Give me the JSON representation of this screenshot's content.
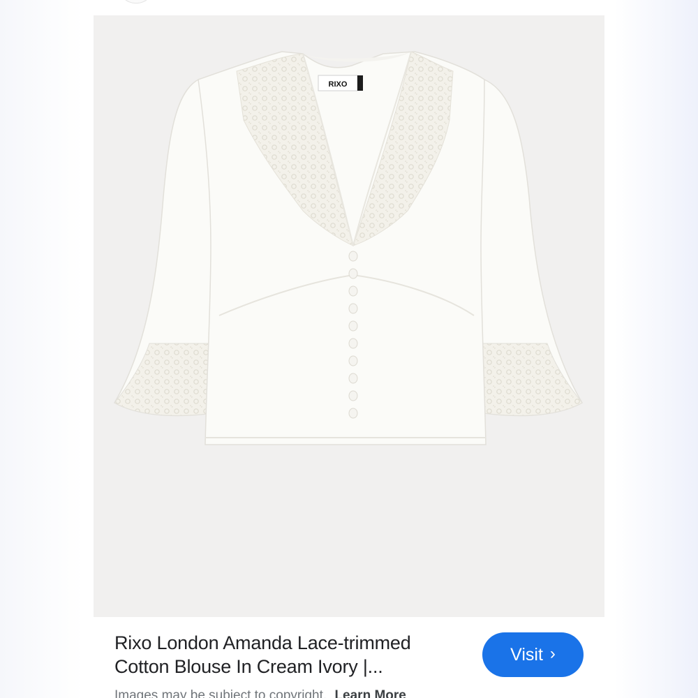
{
  "result": {
    "title_line1": "Rixo London Amanda Lace-trimmed",
    "title_line2": "Cotton Blouse In Cream Ivory |...",
    "visit_label": "Visit",
    "visit_chevron": "›",
    "copyright_text": "Images may be subject to copyright.",
    "learn_more_label": "Learn More",
    "brand_tag": "RIXO"
  },
  "colors": {
    "accent": "#1a73e8",
    "image_background": "#f1f0ef",
    "garment": "#fbfbf8"
  },
  "icons": {
    "visit_icon": "chevron-right-icon"
  }
}
